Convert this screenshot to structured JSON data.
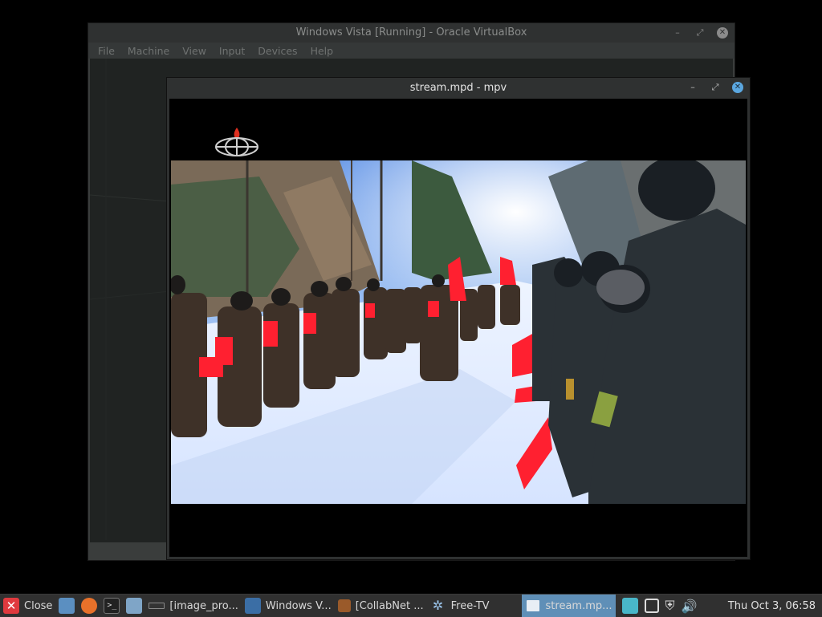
{
  "vbox": {
    "title": "Windows Vista [Running] - Oracle VirtualBox",
    "menu": [
      "File",
      "Machine",
      "View",
      "Input",
      "Devices",
      "Help"
    ]
  },
  "mpv": {
    "title": "stream.mpd - mpv"
  },
  "window_controls": {
    "minimize": "–",
    "maximize": "⤢",
    "close": "✕"
  },
  "taskbar": {
    "close_label": "Close",
    "items": [
      {
        "label": "[image_pro...",
        "icon": "terminal-icon"
      },
      {
        "label": "Windows V...",
        "icon": "virtualbox-icon"
      },
      {
        "label": "[CollabNet ...",
        "icon": "app-icon"
      },
      {
        "label": "Free-TV",
        "icon": "gear-icon"
      },
      {
        "label": "stream.mp...",
        "icon": "mpv-icon",
        "active": true
      }
    ],
    "clock": "Thu Oct  3, 06:58"
  },
  "colors": {
    "accent": "#5ba7e0",
    "close_red": "#e0393e",
    "taskbar_bg": "#303030"
  }
}
